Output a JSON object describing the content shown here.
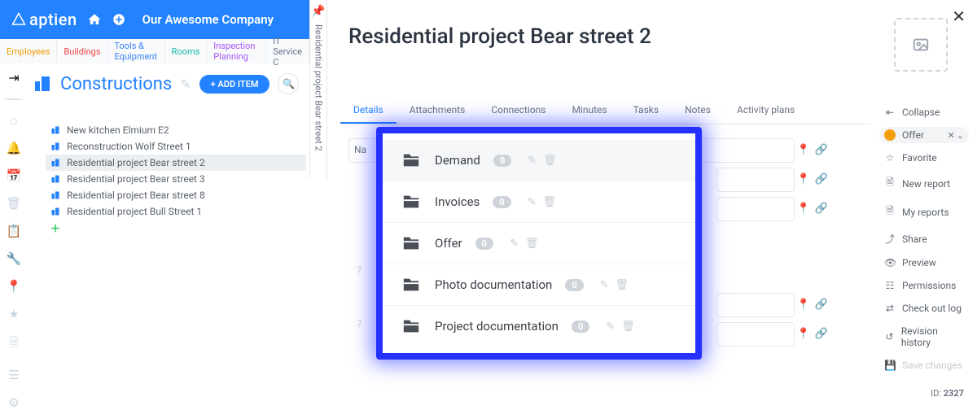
{
  "brand": "aptien",
  "company": "Our Awesome Company",
  "workspace_tabs": [
    "Employees",
    "Buildings",
    "Tools & Equipment",
    "Rooms",
    "Inspection Planning",
    "IT Service C"
  ],
  "organizer": {
    "title": "Constructions",
    "add_label": "+ ADD ITEM",
    "items": [
      "New kitchen Elmium E2",
      "Reconstruction Wolf Street 1",
      "Residential project Bear street 2",
      "Residential project Bear street 3",
      "Residential project Bear street 8",
      "Residential project Bull Street 1"
    ],
    "selected_index": 2
  },
  "breadcrumb_vertical": "Residential project Bear street 2",
  "page_title": "Residential project Bear street 2",
  "detail_tabs": [
    "Details",
    "Attachments",
    "Connections",
    "Minutes",
    "Tasks",
    "Notes",
    "Activity plans"
  ],
  "detail_active": 0,
  "form_first_label": "Na",
  "folders": [
    {
      "name": "Demand",
      "count": 0
    },
    {
      "name": "Invoices",
      "count": 0
    },
    {
      "name": "Offer",
      "count": 0
    },
    {
      "name": "Photo documentation",
      "count": 0
    },
    {
      "name": "Project documentation",
      "count": 0
    }
  ],
  "actions": {
    "collapse": "Collapse",
    "offer": "Offer",
    "favorite": "Favorite",
    "new_report": "New report",
    "my_reports": "My reports",
    "share": "Share",
    "preview": "Preview",
    "permissions": "Permissions",
    "checkout": "Check out log",
    "revision": "Revision history",
    "save": "Save changes"
  },
  "record_id_label": "ID:",
  "record_id": "2327"
}
